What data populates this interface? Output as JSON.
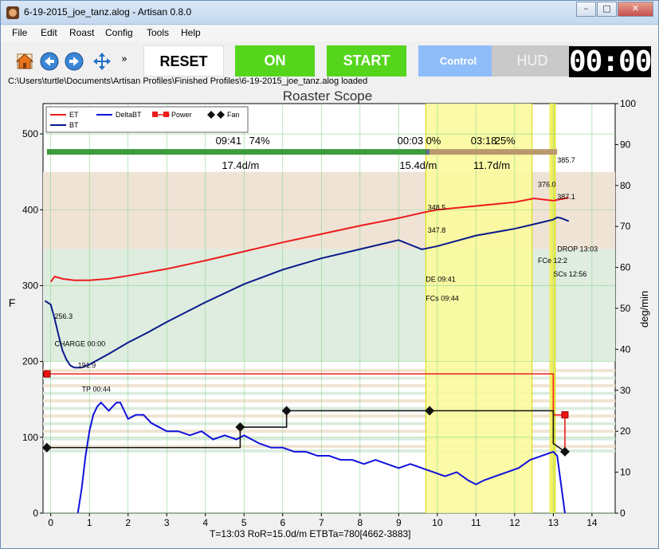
{
  "window": {
    "title": "6-19-2015_joe_tanz.alog - Artisan 0.8.0",
    "minimize_glyph": "–",
    "maximize_glyph": "□",
    "close_glyph": "✕"
  },
  "menu": {
    "items": [
      "File",
      "Edit",
      "Roast",
      "Config",
      "Tools",
      "Help"
    ]
  },
  "toolbar": {
    "more_glyph": "»",
    "reset_label": "RESET",
    "on_label": "ON",
    "start_label": "START",
    "control_label": "Control",
    "hud_label": "HUD",
    "timer": "00:00",
    "icons": [
      "home-icon",
      "back-arrow-icon",
      "forward-arrow-icon",
      "pan-arrows-icon"
    ],
    "colors": {
      "on": "#55d61d",
      "start": "#55d61d",
      "control": "#8fbdfa",
      "hud": "#c9c9c9"
    }
  },
  "status": {
    "path": "C:\\Users\\turtle\\Documents\\Artisan Profiles\\Finished Profiles\\6-19-2015_joe_tanz.alog  loaded",
    "bottom": "T=13:03   RoR=15.0d/m   ETBTa=780[4662-3883]"
  },
  "chart_data": {
    "type": "line",
    "title": "Roaster Scope",
    "ylabel": "F",
    "y2label": "deg/min",
    "xlim": [
      -0.2,
      14.6
    ],
    "ylim": [
      0,
      540
    ],
    "y2lim": [
      0,
      100
    ],
    "x_ticks": [
      0,
      1,
      2,
      3,
      4,
      5,
      6,
      7,
      8,
      9,
      10,
      11,
      12,
      13,
      14
    ],
    "y_ticks": [
      0,
      100,
      200,
      300,
      400,
      500
    ],
    "y2_ticks": [
      0,
      10,
      20,
      30,
      40,
      50,
      60,
      70,
      80,
      90,
      100
    ],
    "legend": [
      "ET",
      "BT",
      "DeltaBT",
      "Power",
      "Fan"
    ],
    "colors": {
      "ET": "#ee1c1c",
      "BT": "#0a1a8a",
      "DeltaBT": "#1111dd",
      "Power": "#ee1c1c",
      "Fan": "#111111"
    },
    "series": [
      {
        "name": "ET",
        "x": [
          0,
          0.1,
          0.3,
          0.6,
          1,
          1.5,
          2,
          3,
          4,
          5,
          6,
          7,
          8,
          9,
          9.6,
          10,
          11,
          12,
          12.5,
          13,
          13.4
        ],
        "y": [
          305,
          312,
          309,
          307,
          307,
          309,
          313,
          322,
          333,
          345,
          357,
          368,
          379,
          389,
          396,
          400,
          405,
          410,
          415,
          412,
          416
        ]
      },
      {
        "name": "BT",
        "x": [
          -0.15,
          0,
          0.1,
          0.2,
          0.3,
          0.4,
          0.5,
          0.6,
          0.7,
          0.8,
          1,
          1.5,
          2,
          2.5,
          3,
          4,
          5,
          6,
          7,
          8,
          9,
          9.6,
          10,
          11,
          12,
          12.5,
          13,
          13.1,
          13.2,
          13.3,
          13.4
        ],
        "y": [
          280,
          275,
          256.3,
          235,
          215,
          203,
          195,
          192,
          191.9,
          192,
          196,
          210,
          225,
          238,
          252,
          278,
          302,
          321,
          336,
          348,
          360,
          347.8,
          352,
          366,
          375,
          381,
          387.1,
          390,
          389,
          387,
          385
        ]
      },
      {
        "name": "DeltaBT",
        "x": [
          0.7,
          0.8,
          0.9,
          1,
          1.1,
          1.2,
          1.3,
          1.4,
          1.5,
          1.6,
          1.7,
          1.8,
          1.9,
          2,
          2.2,
          2.4,
          2.6,
          2.8,
          3,
          3.3,
          3.6,
          3.9,
          4.2,
          4.5,
          4.8,
          5,
          5.2,
          5.4,
          5.7,
          6,
          6.3,
          6.6,
          6.9,
          7.2,
          7.5,
          7.8,
          8.1,
          8.4,
          8.7,
          9,
          9.3,
          9.6,
          9.9,
          10.2,
          10.5,
          10.8,
          11,
          11.2,
          11.5,
          11.8,
          12.1,
          12.4,
          12.7,
          13,
          13.1,
          13.3
        ],
        "y2": [
          0,
          6,
          14,
          20,
          24,
          26,
          27,
          26,
          25,
          26,
          27,
          27,
          25,
          23,
          24,
          24,
          22,
          21,
          20,
          20,
          19,
          20,
          18,
          19,
          18,
          19,
          18,
          17,
          16,
          16,
          15,
          15,
          14,
          14,
          13,
          13,
          12,
          13,
          12,
          11,
          12,
          11,
          10,
          9,
          10,
          8,
          7,
          8,
          9,
          10,
          11,
          13,
          14,
          15,
          14,
          0
        ]
      },
      {
        "name": "Power",
        "x": [
          -0.1,
          13,
          13,
          13.3,
          13.3
        ],
        "y2": [
          34,
          34,
          24,
          24,
          15
        ]
      },
      {
        "name": "Fan",
        "x": [
          -0.1,
          4.9,
          4.9,
          6.1,
          6.1,
          9.8,
          13,
          13,
          13.3
        ],
        "y2": [
          16,
          16,
          21,
          21,
          25,
          25,
          25,
          17,
          15
        ]
      }
    ],
    "phase_bands": [
      {
        "x": [
          -0.1,
          9.7
        ],
        "pct": "74%",
        "time": "09:41",
        "rate": "17.4d/m"
      },
      {
        "x": [
          9.7,
          9.8
        ],
        "pct": "0%",
        "time": "00:03",
        "rate": "15.4d/m"
      },
      {
        "x": [
          9.8,
          13.1
        ],
        "pct": "25%",
        "time": "03:18",
        "rate": "11.7d/m"
      }
    ],
    "annotations": [
      {
        "text": "256.3",
        "x": 0.1,
        "y": 256.3
      },
      {
        "text": "CHARGE 00:00",
        "x": 0.1,
        "y": 220
      },
      {
        "text": "191.9",
        "x": 0.7,
        "y": 191.9
      },
      {
        "text": "TP 00:44",
        "x": 0.8,
        "y": 160
      },
      {
        "text": "348.5",
        "x": 9.75,
        "y": 400
      },
      {
        "text": "347.8",
        "x": 9.75,
        "y": 370
      },
      {
        "text": "DE 09:41",
        "x": 9.7,
        "y": 305
      },
      {
        "text": "FCs 09:44",
        "x": 9.7,
        "y": 280
      },
      {
        "text": "376.0",
        "x": 12.6,
        "y": 430
      },
      {
        "text": "FCe 12:2",
        "x": 12.6,
        "y": 330
      },
      {
        "text": "385.7",
        "x": 13.1,
        "y": 462
      },
      {
        "text": "387.1",
        "x": 13.1,
        "y": 414
      },
      {
        "text": "DROP 13:03",
        "x": 13.1,
        "y": 345
      },
      {
        "text": "SCs 12:56",
        "x": 13.0,
        "y": 312
      }
    ]
  }
}
